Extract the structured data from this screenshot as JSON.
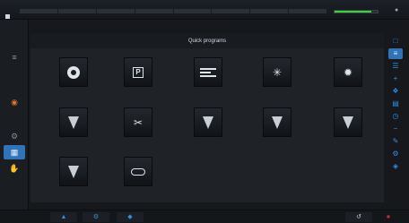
{
  "topbar": {
    "segments": [
      "",
      "",
      "",
      "",
      "",
      "",
      "",
      ""
    ],
    "progress_fraction": 0.85,
    "progress_color": "#3cd23c",
    "value_text": "",
    "icon": "pin-icon"
  },
  "leftbar": {
    "items": [
      {
        "icon": "laser-head-icon",
        "label": ""
      },
      {
        "icon": "power-icon",
        "label": ""
      },
      {
        "icon": "gear-icon",
        "label": ""
      },
      {
        "icon": "grid-icon",
        "label": ""
      },
      {
        "icon": "hand-icon",
        "label": ""
      }
    ],
    "accent_color": "#e0702a"
  },
  "panel": {
    "title": "Quick programs"
  },
  "tiles": [
    {
      "label": "",
      "icon": "target-icon"
    },
    {
      "label": "",
      "icon": "p-letter-icon"
    },
    {
      "label": "",
      "icon": "bars-icon"
    },
    {
      "label": "",
      "icon": "laser-starburst-icon"
    },
    {
      "label": "",
      "icon": "laser-burst-icon"
    },
    {
      "label": "",
      "icon": "nozzle-rotate-icon"
    },
    {
      "label": "",
      "icon": "scissors-icon"
    },
    {
      "label": "",
      "icon": "nozzle-icon"
    },
    {
      "label": "",
      "icon": "nozzle-crosshair-icon"
    },
    {
      "label": "",
      "icon": "nozzle-crosshair-alt-icon"
    },
    {
      "label": "",
      "icon": "nozzle-single-icon"
    },
    {
      "label": "",
      "icon": "ring-icon"
    }
  ],
  "rightbar": {
    "icons": [
      "window-icon",
      "laser-head-icon",
      "stack-icon",
      "plus-icon",
      "tool-icon",
      "chart-icon",
      "clock-icon",
      "minus-icon",
      "pencil-icon",
      "gear-icon",
      "shield-icon"
    ]
  },
  "bottombar": {
    "left_icons": [
      "plane-icon",
      "settings-icon",
      "plane-alt-icon"
    ],
    "right_icons": [
      "exit-icon",
      "stop-icon"
    ],
    "accent_color": "#2f8fe0"
  }
}
